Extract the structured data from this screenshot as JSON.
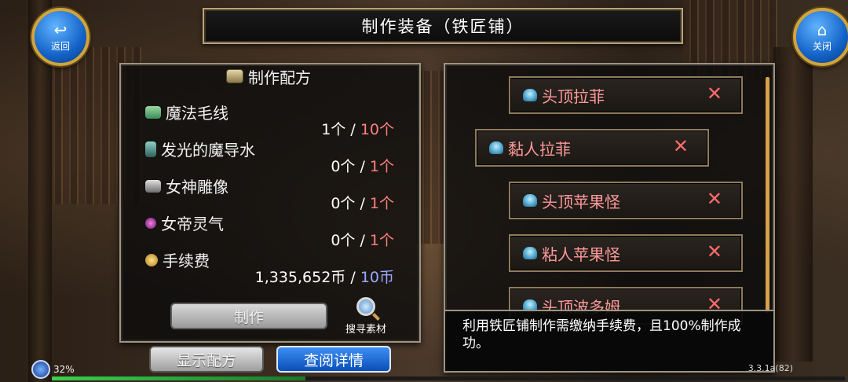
{
  "header": {
    "title": "制作装备（铁匠铺）"
  },
  "nav": {
    "back_label": "返回",
    "close_label": "关闭"
  },
  "recipe": {
    "title": "制作配方",
    "materials": [
      {
        "name": "魔法毛线",
        "have": "1个",
        "need": "10个",
        "icon": "yarn-icon"
      },
      {
        "name": "发光的魔导水",
        "have": "0个",
        "need": "1个",
        "icon": "potion-icon"
      },
      {
        "name": "女神雕像",
        "have": "0个",
        "need": "1个",
        "icon": "statue-icon"
      },
      {
        "name": "女帝灵气",
        "have": "0个",
        "need": "1个",
        "icon": "aura-icon"
      }
    ],
    "fee": {
      "name": "手续费",
      "have": "1,335,652币",
      "need": "10币",
      "icon": "coin-icon"
    },
    "separator": "/",
    "craft_button": "制作",
    "search_label": "搜寻素材"
  },
  "buttons": {
    "show_recipe": "显示配方",
    "view_detail": "查阅详情"
  },
  "list": {
    "items": [
      {
        "label": "头顶拉菲"
      },
      {
        "label": "黏人拉菲"
      },
      {
        "label": "头顶苹果怪"
      },
      {
        "label": "粘人苹果怪"
      },
      {
        "label": "头顶波多姆"
      }
    ],
    "remove_symbol": "✕"
  },
  "description": "利用铁匠铺制作需缴纳手续费，且100%制作成功。",
  "status": {
    "battery": "32%",
    "progress": 0.32,
    "version": "3.3.1a(82)"
  },
  "colors": {
    "need_red": "#ff8080",
    "need_blue": "#9aa8ff",
    "list_text": "#ff9a9a",
    "accent_gold": "#d1a43c"
  }
}
